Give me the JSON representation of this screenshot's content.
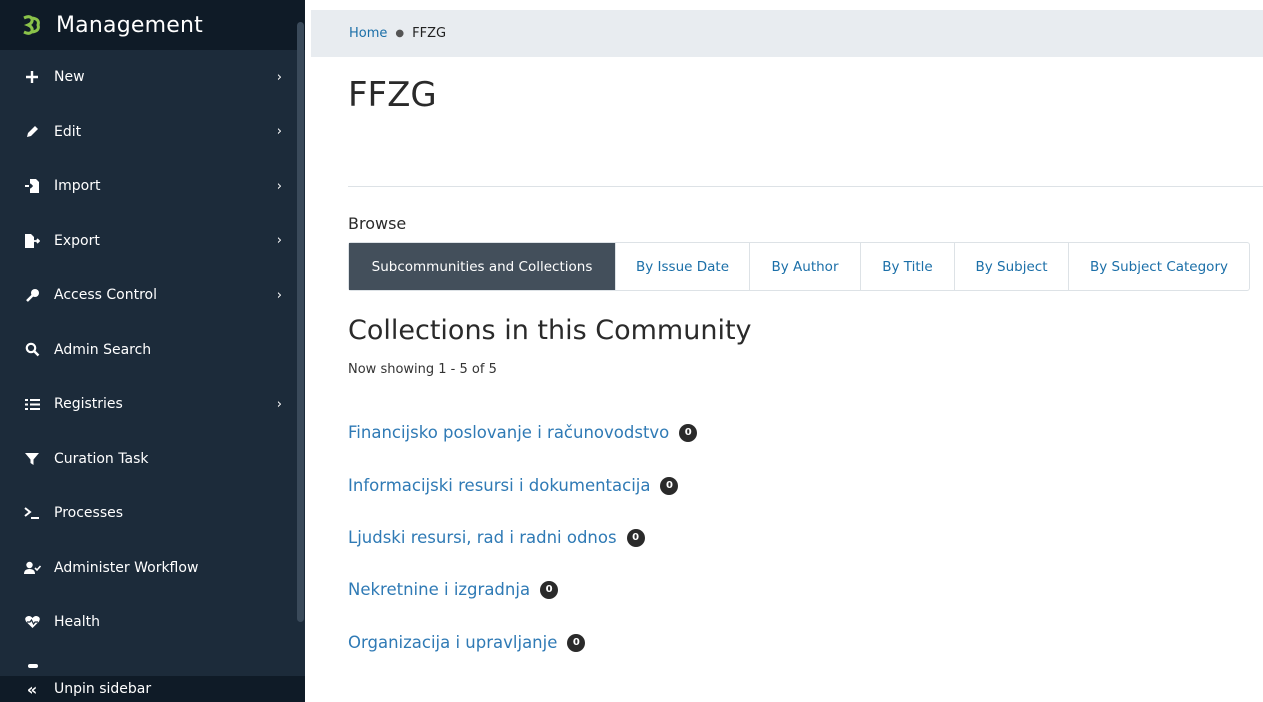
{
  "sidebar": {
    "title": "Management",
    "items": [
      {
        "label": "New",
        "icon": "plus-icon",
        "has_submenu": true
      },
      {
        "label": "Edit",
        "icon": "pencil-icon",
        "has_submenu": true
      },
      {
        "label": "Import",
        "icon": "file-import-icon",
        "has_submenu": true
      },
      {
        "label": "Export",
        "icon": "file-export-icon",
        "has_submenu": true
      },
      {
        "label": "Access Control",
        "icon": "key-icon",
        "has_submenu": true
      },
      {
        "label": "Admin Search",
        "icon": "search-icon",
        "has_submenu": false
      },
      {
        "label": "Registries",
        "icon": "list-icon",
        "has_submenu": true
      },
      {
        "label": "Curation Task",
        "icon": "filter-icon",
        "has_submenu": false
      },
      {
        "label": "Processes",
        "icon": "terminal-icon",
        "has_submenu": false
      },
      {
        "label": "Administer Workflow",
        "icon": "user-check-icon",
        "has_submenu": false
      },
      {
        "label": "Health",
        "icon": "heartbeat-icon",
        "has_submenu": false
      }
    ],
    "unpin_label": "Unpin sidebar"
  },
  "breadcrumb": {
    "home": "Home",
    "current": "FFZG"
  },
  "page": {
    "title": "FFZG",
    "browse_label": "Browse",
    "tabs": [
      {
        "label": "Subcommunities and Collections",
        "active": true
      },
      {
        "label": "By Issue Date",
        "active": false
      },
      {
        "label": "By Author",
        "active": false
      },
      {
        "label": "By Title",
        "active": false
      },
      {
        "label": "By Subject",
        "active": false
      },
      {
        "label": "By Subject Category",
        "active": false
      }
    ],
    "section_title": "Collections in this Community",
    "showing": "Now showing 1 - 5 of 5",
    "collections": [
      {
        "name": "Financijsko poslovanje i računovodstvo",
        "count": "0"
      },
      {
        "name": "Informacijski resursi i dokumentacija",
        "count": "0"
      },
      {
        "name": "Ljudski resursi, rad i radni odnos",
        "count": "0"
      },
      {
        "name": "Nekretnine i izgradnja",
        "count": "0"
      },
      {
        "name": "Organizacija i upravljanje",
        "count": "0"
      }
    ]
  },
  "colors": {
    "sidebar_bg": "#1c2b3a",
    "sidebar_header_bg": "#0f1b27",
    "accent": "#43515f",
    "link": "#2f7ab5",
    "logo": "#8bc34a"
  }
}
